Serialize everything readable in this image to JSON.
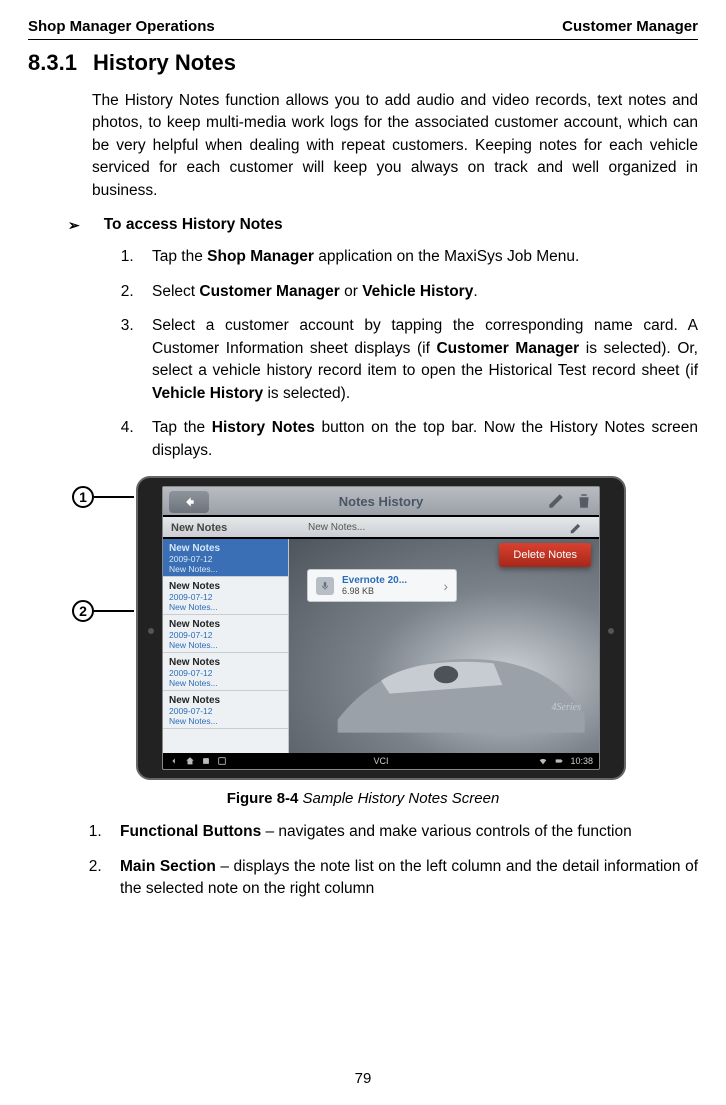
{
  "header": {
    "left": "Shop Manager Operations",
    "right": "Customer Manager"
  },
  "section": {
    "number": "8.3.1",
    "title": "History Notes"
  },
  "intro": "The History Notes function allows you to add audio and video records, text notes and photos, to keep multi-media work logs for the associated customer account, which can be very helpful when dealing with repeat customers. Keeping notes for each vehicle serviced for each customer will keep you always on track and well organized in business.",
  "procedure_title": "To access History Notes",
  "steps": {
    "s1a": "Tap the ",
    "s1b": "Shop Manager",
    "s1c": " application on the MaxiSys Job Menu.",
    "s2a": "Select ",
    "s2b": "Customer Manager",
    "s2c": " or ",
    "s2d": "Vehicle History",
    "s2e": ".",
    "s3a": "Select a customer account by tapping the corresponding name card. A Customer Information sheet displays (if ",
    "s3b": "Customer Manager",
    "s3c": " is selected). Or, select a vehicle history record item to open the Historical Test record sheet (if ",
    "s3d": "Vehicle History",
    "s3e": " is selected).",
    "s4a": "Tap the ",
    "s4b": "History Notes",
    "s4c": " button on the top bar. Now the History Notes screen displays."
  },
  "callouts": {
    "c1": "1",
    "c2": "2"
  },
  "figure": {
    "titlebar": "Notes History",
    "subbar_left": "New Notes",
    "subbar_center": "New Notes...",
    "note_title": "New Notes",
    "note_date": "2009-07-12",
    "note_sub": "New Notes...",
    "delete_label": "Delete Notes",
    "attach_name": "Evernote 20...",
    "attach_size": "6.98 KB",
    "series_badge": "4Series",
    "vci_label": "VCI",
    "clock": "10:38"
  },
  "caption": {
    "label": "Figure 8-4",
    "text": " Sample History Notes Screen"
  },
  "desc": {
    "d1a": "Functional Buttons",
    "d1b": " – navigates and make various controls of the function",
    "d2a": "Main Section",
    "d2b": " – displays the note list on the left column and the detail information of the selected note on the right column"
  },
  "page_number": "79"
}
